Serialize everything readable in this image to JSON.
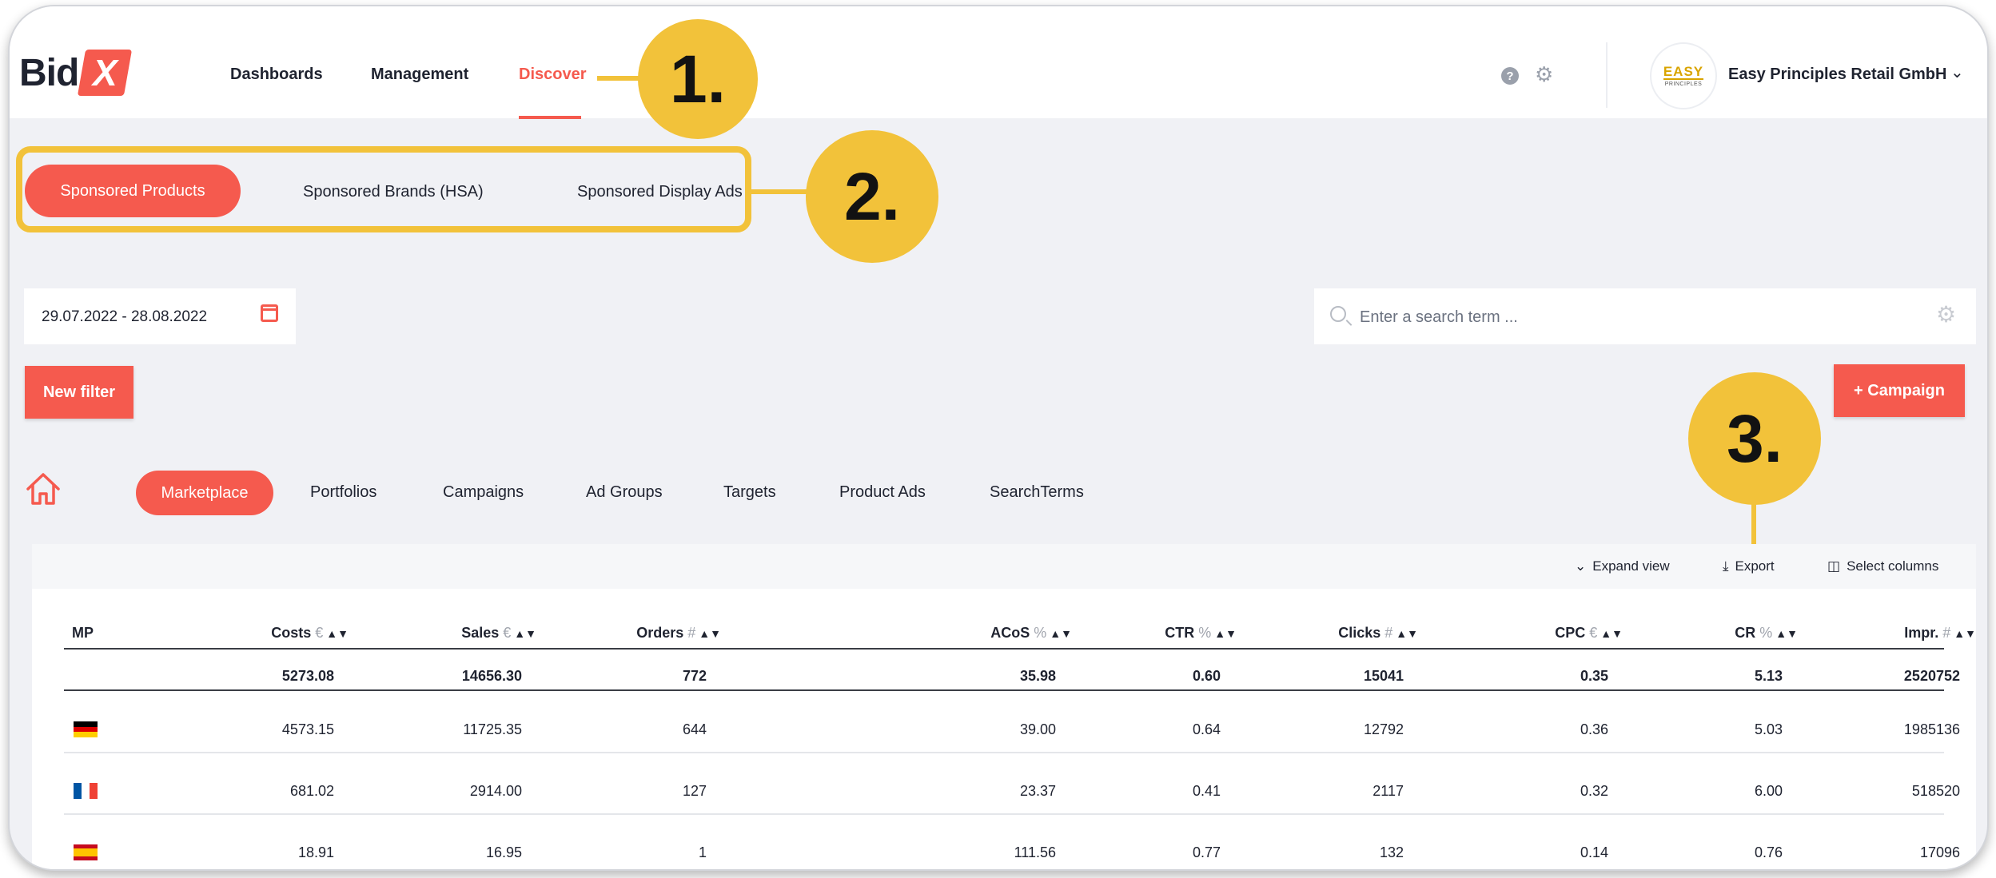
{
  "header": {
    "logo_text": "Bid",
    "logo_mark": "X",
    "nav": [
      "Dashboards",
      "Management",
      "Discover"
    ],
    "active_nav": "Discover",
    "help_icon": "help-circle-icon",
    "settings_icon": "gear-icon",
    "company_logo_text": "EASY",
    "company_logo_sub": "PRINCIPLES",
    "company_name": "Easy Principles Retail GmbH"
  },
  "callouts": [
    "1.",
    "2.",
    "3."
  ],
  "ad_types": [
    "Sponsored Products",
    "Sponsored Brands (HSA)",
    "Sponsored Display Ads"
  ],
  "filters": {
    "date_range": "29.07.2022 - 28.08.2022",
    "search_placeholder": "Enter a search term ...",
    "new_filter_label": "New filter",
    "campaign_label": "+ Campaign"
  },
  "levels": [
    "Marketplace",
    "Portfolios",
    "Campaigns",
    "Ad Groups",
    "Targets",
    "Product Ads",
    "SearchTerms"
  ],
  "toolbar": {
    "expand_view": "Expand view",
    "export": "Export",
    "select_columns": "Select columns"
  },
  "table": {
    "columns": [
      {
        "label": "MP",
        "unit": ""
      },
      {
        "label": "Costs",
        "unit": "€"
      },
      {
        "label": "Sales",
        "unit": "€"
      },
      {
        "label": "Orders",
        "unit": "#"
      },
      {
        "label": "ACoS",
        "unit": "%"
      },
      {
        "label": "CTR",
        "unit": "%"
      },
      {
        "label": "Clicks",
        "unit": "#"
      },
      {
        "label": "CPC",
        "unit": "€"
      },
      {
        "label": "CR",
        "unit": "%"
      },
      {
        "label": "Impr.",
        "unit": "#"
      }
    ],
    "totals": [
      "5273.08",
      "14656.30",
      "772",
      "35.98",
      "0.60",
      "15041",
      "0.35",
      "5.13",
      "2520752"
    ],
    "rows": [
      {
        "flag": "germany-flag-icon",
        "values": [
          "4573.15",
          "11725.35",
          "644",
          "39.00",
          "0.64",
          "12792",
          "0.36",
          "5.03",
          "1985136"
        ]
      },
      {
        "flag": "france-flag-icon",
        "values": [
          "681.02",
          "2914.00",
          "127",
          "23.37",
          "0.41",
          "2117",
          "0.32",
          "6.00",
          "518520"
        ]
      },
      {
        "flag": "spain-flag-icon",
        "values": [
          "18.91",
          "16.95",
          "1",
          "111.56",
          "0.77",
          "132",
          "0.14",
          "0.76",
          "17096"
        ]
      }
    ]
  },
  "colors": {
    "accent": "#f55a4e",
    "callout": "#f2c23a",
    "background": "#f0f1f5"
  }
}
